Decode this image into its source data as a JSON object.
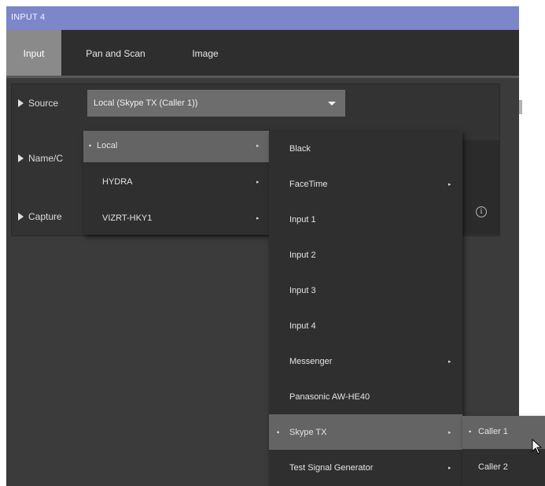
{
  "window": {
    "title": "INPUT 4"
  },
  "tabs": [
    {
      "label": "Input",
      "active": true
    },
    {
      "label": "Pan and Scan",
      "active": false
    },
    {
      "label": "Image",
      "active": false
    }
  ],
  "rows": {
    "source": {
      "label": "Source",
      "value": "Local (Skype TX (Caller 1))"
    },
    "name": {
      "label": "Name/C"
    },
    "capture": {
      "label": "Capture"
    }
  },
  "menu_level1": {
    "items": [
      {
        "label": "Local",
        "selected": true,
        "has_submenu": true
      },
      {
        "label": "HYDRA",
        "selected": false,
        "has_submenu": true
      },
      {
        "label": "VIZRT-HKY1",
        "selected": false,
        "has_submenu": true
      }
    ]
  },
  "menu_level2": {
    "items": [
      {
        "label": "Black",
        "has_submenu": false,
        "selected": false
      },
      {
        "label": "FaceTime",
        "has_submenu": true,
        "selected": false
      },
      {
        "label": "Input 1",
        "has_submenu": false,
        "selected": false
      },
      {
        "label": "Input 2",
        "has_submenu": false,
        "selected": false
      },
      {
        "label": "Input 3",
        "has_submenu": false,
        "selected": false
      },
      {
        "label": "Input 4",
        "has_submenu": false,
        "selected": false
      },
      {
        "label": "Messenger",
        "has_submenu": true,
        "selected": false
      },
      {
        "label": "Panasonic AW-HE40",
        "has_submenu": false,
        "selected": false
      },
      {
        "label": "Skype TX",
        "has_submenu": true,
        "selected": true
      },
      {
        "label": "Test Signal Generator",
        "has_submenu": true,
        "selected": false
      }
    ]
  },
  "menu_level3": {
    "items": [
      {
        "label": "Caller 1",
        "selected": true
      },
      {
        "label": "Caller 2",
        "selected": false
      }
    ]
  },
  "glyphs": {
    "bullet": "•",
    "arrow": "▸",
    "info": "i"
  },
  "colors": {
    "titlebar": "#7c86c9",
    "highlight": "#646464",
    "tab_active": "#8a8a8a"
  }
}
